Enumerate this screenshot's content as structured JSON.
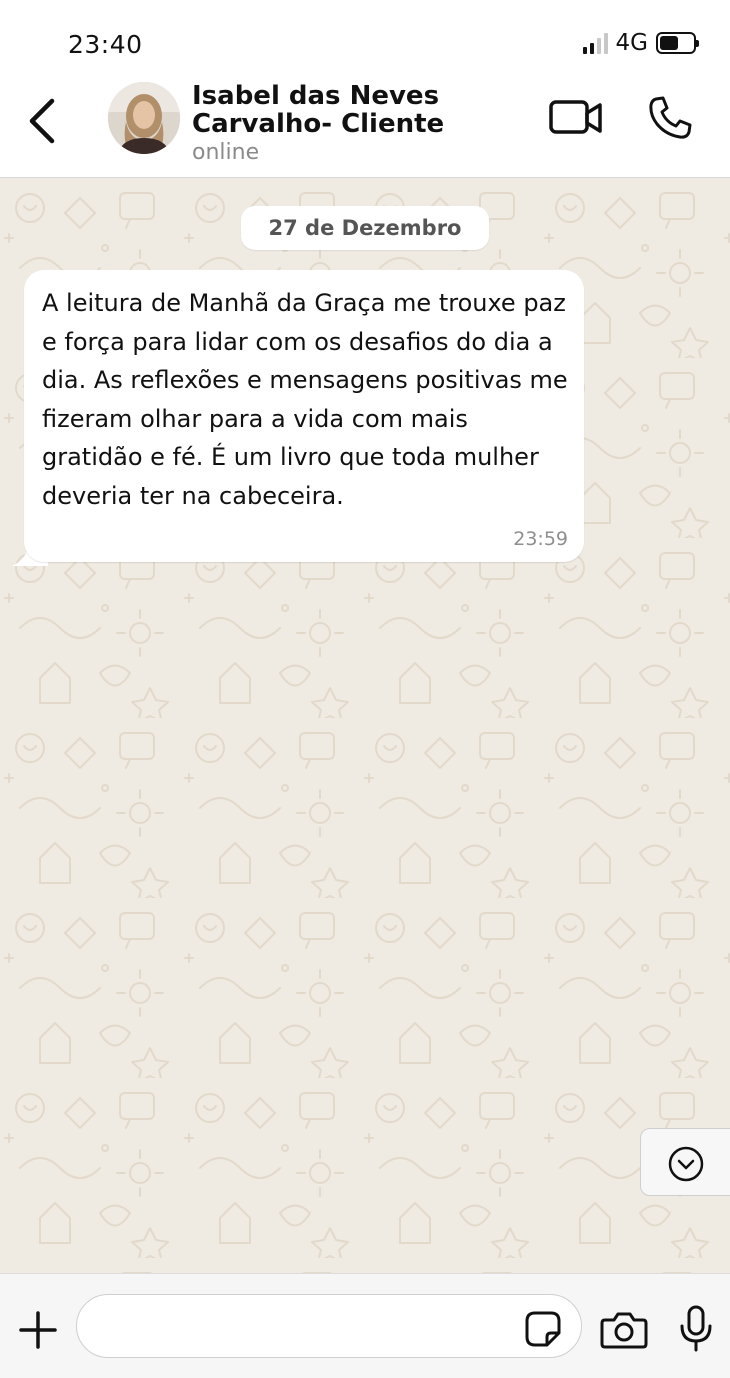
{
  "status_bar": {
    "time": "23:40",
    "network": "4G",
    "signal_bars_active": 2,
    "signal_bars_total": 4,
    "battery_level": 0.5
  },
  "header": {
    "back_icon": "chevron-left-icon",
    "contact_name": "Isabel das Neves Carvalho- Cliente",
    "contact_status": "online",
    "video_icon": "video-camera-icon",
    "call_icon": "phone-icon"
  },
  "chat": {
    "date_label": "27 de Dezembro",
    "messages": [
      {
        "direction": "incoming",
        "text": "A leitura de Manhã da Graça me trouxe paz e força para lidar com os desafios do dia a dia. As reflexões e mensagens positivas me fizeram olhar para a vida com mais gratidão e fé. É um livro que toda mulher deveria ter na cabeceira.",
        "time": "23:59"
      }
    ],
    "scroll_down_icon": "chevron-down-circle-icon"
  },
  "input_bar": {
    "plus_icon": "plus-icon",
    "message_value": "",
    "sticker_icon": "sticker-icon",
    "camera_icon": "camera-icon",
    "mic_icon": "microphone-icon"
  },
  "colors": {
    "chat_background": "#efeae2",
    "bubble_incoming": "#ffffff",
    "icon_color": "#111111",
    "muted_text": "#8a8a8a"
  }
}
